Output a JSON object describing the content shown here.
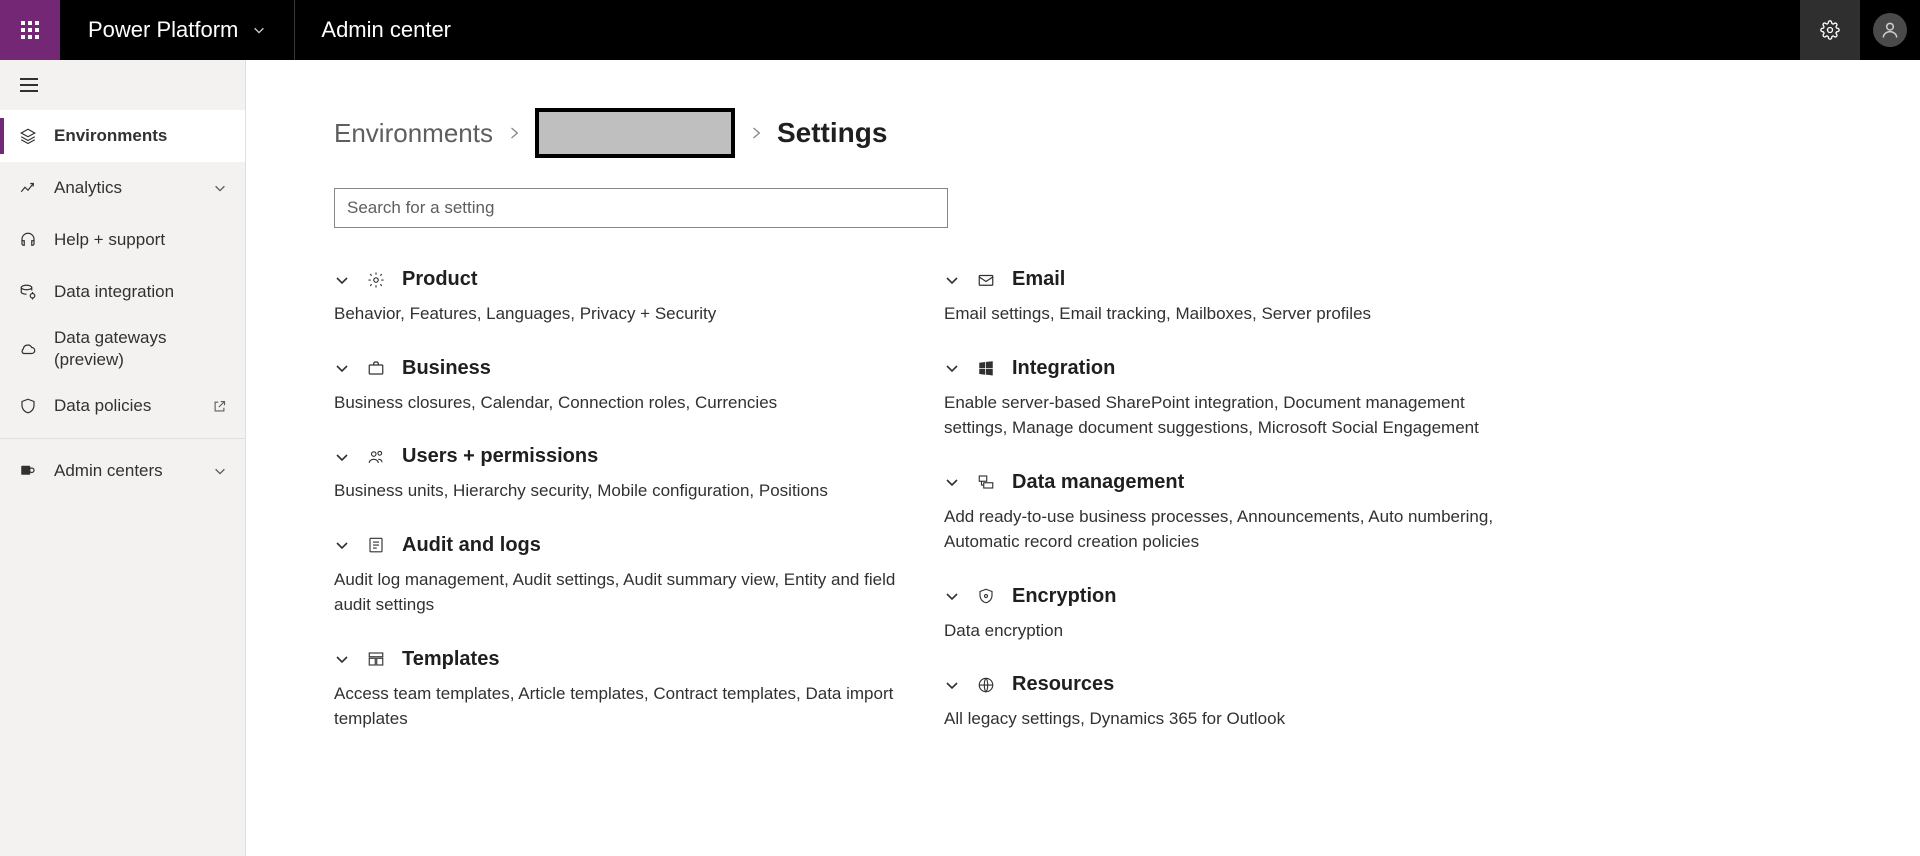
{
  "topbar": {
    "brand": "Power Platform",
    "title": "Admin center"
  },
  "sidebar": {
    "items": [
      {
        "label": "Environments"
      },
      {
        "label": "Analytics"
      },
      {
        "label": "Help + support"
      },
      {
        "label": "Data integration"
      },
      {
        "label": "Data gateways",
        "sublabel": "(preview)"
      },
      {
        "label": "Data policies"
      },
      {
        "label": "Admin centers"
      }
    ]
  },
  "breadcrumb": {
    "root": "Environments",
    "current": "Settings"
  },
  "search": {
    "placeholder": "Search for a setting"
  },
  "settings": {
    "left": [
      {
        "title": "Product",
        "desc": "Behavior, Features, Languages, Privacy + Security"
      },
      {
        "title": "Business",
        "desc": "Business closures, Calendar, Connection roles, Currencies"
      },
      {
        "title": "Users + permissions",
        "desc": "Business units, Hierarchy security, Mobile configuration, Positions"
      },
      {
        "title": "Audit and logs",
        "desc": "Audit log management, Audit settings, Audit summary view, Entity and field audit settings"
      },
      {
        "title": "Templates",
        "desc": "Access team templates, Article templates, Contract templates, Data import templates"
      }
    ],
    "right": [
      {
        "title": "Email",
        "desc": "Email settings, Email tracking, Mailboxes, Server profiles"
      },
      {
        "title": "Integration",
        "desc": "Enable server-based SharePoint integration, Document management settings, Manage document suggestions, Microsoft Social Engagement"
      },
      {
        "title": "Data management",
        "desc": "Add ready-to-use business processes, Announcements, Auto numbering, Automatic record creation policies"
      },
      {
        "title": "Encryption",
        "desc": "Data encryption"
      },
      {
        "title": "Resources",
        "desc": "All legacy settings, Dynamics 365 for Outlook"
      }
    ]
  }
}
